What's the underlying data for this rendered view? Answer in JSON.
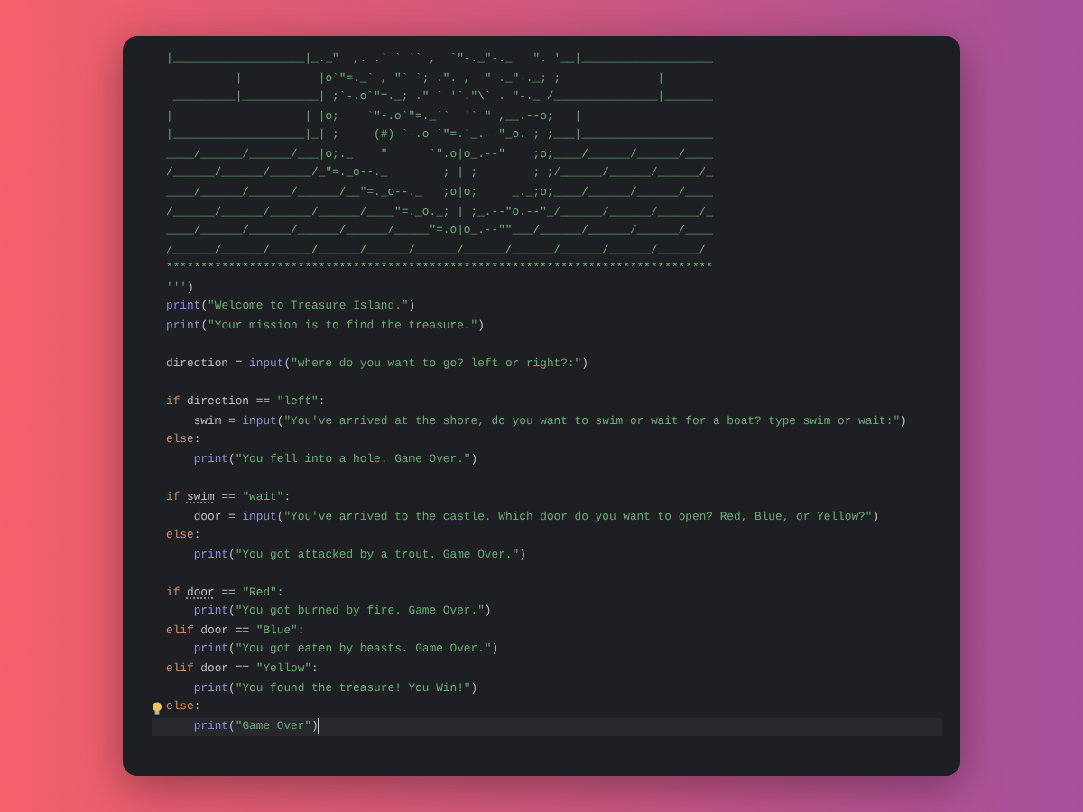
{
  "editor": {
    "lines": [
      {
        "kind": "art",
        "current": false,
        "text": "|___________________|_._\"  ,. .` ` `` ,  `\"-._\"-._   \". '__|___________________"
      },
      {
        "kind": "art",
        "current": false,
        "text": "          |           |o`\"=._` , \"` `; .\". ,  \"-._\"-._; ;              |"
      },
      {
        "kind": "art",
        "current": false,
        "text": " _________|___________| ;`-.o`\"=._; .\" ` '`.\"\\` . \"-._ /_______________|_______"
      },
      {
        "kind": "art",
        "current": false,
        "text": "|                   | |o;    `\"-.o`\"=._``  '` \" ,__.--o;   |"
      },
      {
        "kind": "art",
        "current": false,
        "text": "|___________________|_| ;     (#) `-.o `\"=.`_.--\"_o.-; ;___|___________________"
      },
      {
        "kind": "art",
        "current": false,
        "text": "____/______/______/___|o;._    \"      `\".o|o_.--\"    ;o;____/______/______/____"
      },
      {
        "kind": "art",
        "current": false,
        "text": "/______/______/______/_\"=._o--._        ; | ;        ; ;/______/______/______/_"
      },
      {
        "kind": "art",
        "current": false,
        "text": "____/______/______/______/__\"=._o--._   ;o|o;     _._;o;____/______/______/____"
      },
      {
        "kind": "art",
        "current": false,
        "text": "/______/______/______/______/____\"=._o._; | ;_.--\"o.--\"_/______/______/______/_"
      },
      {
        "kind": "art",
        "current": false,
        "text": "____/______/______/______/______/_____\"=.o|o_.--\"\"___/______/______/______/____"
      },
      {
        "kind": "art",
        "current": false,
        "text": "/______/______/______/______/______/______/______/______/______/______/______/"
      },
      {
        "kind": "art",
        "current": false,
        "text": "*******************************************************************************"
      },
      {
        "kind": "code",
        "current": false,
        "tokens": [
          {
            "kind": "string",
            "text": "'''"
          },
          {
            "kind": "plain",
            "text": ")"
          }
        ]
      },
      {
        "kind": "code",
        "current": false,
        "tokens": [
          {
            "kind": "builtin",
            "text": "print"
          },
          {
            "kind": "plain",
            "text": "("
          },
          {
            "kind": "string",
            "text": "\"Welcome to Treasure Island.\""
          },
          {
            "kind": "plain",
            "text": ")"
          }
        ]
      },
      {
        "kind": "code",
        "current": false,
        "tokens": [
          {
            "kind": "builtin",
            "text": "print"
          },
          {
            "kind": "plain",
            "text": "("
          },
          {
            "kind": "string",
            "text": "\"Your mission is to find the treasure.\""
          },
          {
            "kind": "plain",
            "text": ")"
          }
        ]
      },
      {
        "kind": "blank",
        "current": false
      },
      {
        "kind": "code",
        "current": false,
        "tokens": [
          {
            "kind": "plain",
            "text": "direction = "
          },
          {
            "kind": "builtin",
            "text": "input"
          },
          {
            "kind": "plain",
            "text": "("
          },
          {
            "kind": "string",
            "text": "\"where do you want to go? left or right?:\""
          },
          {
            "kind": "plain",
            "text": ")"
          }
        ]
      },
      {
        "kind": "blank",
        "current": false
      },
      {
        "kind": "code",
        "current": false,
        "tokens": [
          {
            "kind": "keyword",
            "text": "if"
          },
          {
            "kind": "plain",
            "text": " direction == "
          },
          {
            "kind": "string",
            "text": "\"left\""
          },
          {
            "kind": "plain",
            "text": ":"
          }
        ]
      },
      {
        "kind": "code",
        "current": false,
        "tokens": [
          {
            "kind": "plain",
            "text": "    swim = "
          },
          {
            "kind": "builtin",
            "text": "input"
          },
          {
            "kind": "plain",
            "text": "("
          },
          {
            "kind": "string",
            "text": "\"You've arrived at the shore, do you want to swim or wait for a boat? type swim or wait:\""
          },
          {
            "kind": "plain",
            "text": ")"
          }
        ]
      },
      {
        "kind": "code",
        "current": false,
        "tokens": [
          {
            "kind": "keyword",
            "text": "else"
          },
          {
            "kind": "plain",
            "text": ":"
          }
        ]
      },
      {
        "kind": "code",
        "current": false,
        "tokens": [
          {
            "kind": "builtin",
            "text": "    print"
          },
          {
            "kind": "plain",
            "text": "("
          },
          {
            "kind": "string",
            "text": "\"You fell into a hole. Game Over.\""
          },
          {
            "kind": "plain",
            "text": ")"
          }
        ]
      },
      {
        "kind": "blank",
        "current": false
      },
      {
        "kind": "code",
        "current": false,
        "tokens": [
          {
            "kind": "keyword",
            "text": "if "
          },
          {
            "kind": "warning",
            "text": "swim"
          },
          {
            "kind": "plain",
            "text": " == "
          },
          {
            "kind": "string",
            "text": "\"wait\""
          },
          {
            "kind": "plain",
            "text": ":"
          }
        ]
      },
      {
        "kind": "code",
        "current": false,
        "tokens": [
          {
            "kind": "plain",
            "text": "    door = "
          },
          {
            "kind": "builtin",
            "text": "input"
          },
          {
            "kind": "plain",
            "text": "("
          },
          {
            "kind": "string",
            "text": "\"You've arrived to the castle. Which door do you want to open? Red, Blue, or Yellow?\""
          },
          {
            "kind": "plain",
            "text": ")"
          }
        ]
      },
      {
        "kind": "code",
        "current": false,
        "tokens": [
          {
            "kind": "keyword",
            "text": "else"
          },
          {
            "kind": "plain",
            "text": ":"
          }
        ]
      },
      {
        "kind": "code",
        "current": false,
        "tokens": [
          {
            "kind": "builtin",
            "text": "    print"
          },
          {
            "kind": "plain",
            "text": "("
          },
          {
            "kind": "string",
            "text": "\"You got attacked by a trout. Game Over.\""
          },
          {
            "kind": "plain",
            "text": ")"
          }
        ]
      },
      {
        "kind": "blank",
        "current": false
      },
      {
        "kind": "code",
        "current": false,
        "tokens": [
          {
            "kind": "keyword",
            "text": "if "
          },
          {
            "kind": "warning",
            "text": "door"
          },
          {
            "kind": "plain",
            "text": " == "
          },
          {
            "kind": "string",
            "text": "\"Red\""
          },
          {
            "kind": "plain",
            "text": ":"
          }
        ]
      },
      {
        "kind": "code",
        "current": false,
        "tokens": [
          {
            "kind": "builtin",
            "text": "    print"
          },
          {
            "kind": "plain",
            "text": "("
          },
          {
            "kind": "string",
            "text": "\"You got burned by fire. Game Over.\""
          },
          {
            "kind": "plain",
            "text": ")"
          }
        ]
      },
      {
        "kind": "code",
        "current": false,
        "tokens": [
          {
            "kind": "keyword",
            "text": "elif"
          },
          {
            "kind": "plain",
            "text": " door == "
          },
          {
            "kind": "string",
            "text": "\"Blue\""
          },
          {
            "kind": "plain",
            "text": ":"
          }
        ]
      },
      {
        "kind": "code",
        "current": false,
        "tokens": [
          {
            "kind": "builtin",
            "text": "    print"
          },
          {
            "kind": "plain",
            "text": "("
          },
          {
            "kind": "string",
            "text": "\"You got eaten by beasts. Game Over.\""
          },
          {
            "kind": "plain",
            "text": ")"
          }
        ]
      },
      {
        "kind": "code",
        "current": false,
        "tokens": [
          {
            "kind": "keyword",
            "text": "elif"
          },
          {
            "kind": "plain",
            "text": " door == "
          },
          {
            "kind": "string",
            "text": "\"Yellow\""
          },
          {
            "kind": "plain",
            "text": ":"
          }
        ]
      },
      {
        "kind": "code",
        "current": false,
        "tokens": [
          {
            "kind": "builtin",
            "text": "    print"
          },
          {
            "kind": "plain",
            "text": "("
          },
          {
            "kind": "string",
            "text": "\"You found the treasure! You Win!\""
          },
          {
            "kind": "plain",
            "text": ")"
          }
        ]
      },
      {
        "kind": "code",
        "current": false,
        "hint": true,
        "tokens": [
          {
            "kind": "keyword",
            "text": "else"
          },
          {
            "kind": "plain",
            "text": ":"
          }
        ]
      },
      {
        "kind": "code",
        "current": true,
        "tokens": [
          {
            "kind": "builtin",
            "text": "    print"
          },
          {
            "kind": "plain",
            "text": "("
          },
          {
            "kind": "string",
            "text": "\"Game Over\""
          },
          {
            "kind": "plain",
            "text": ")"
          }
        ]
      }
    ]
  }
}
